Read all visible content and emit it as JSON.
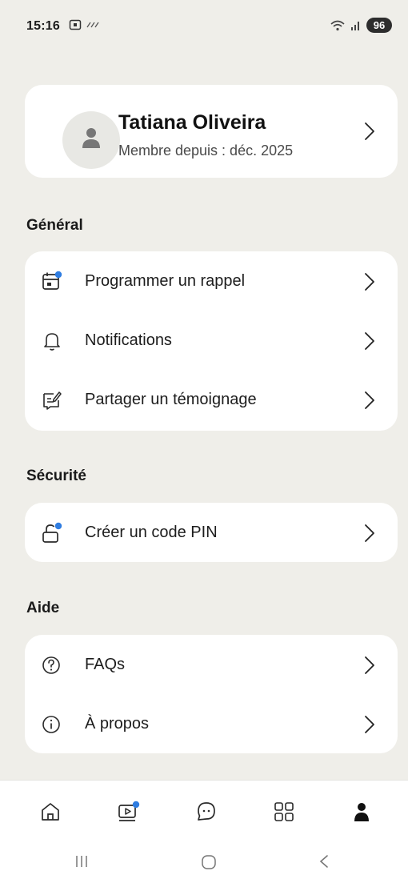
{
  "status": {
    "time": "15:16",
    "battery": "96"
  },
  "profile": {
    "name": "Tatiana Oliveira",
    "member_since": "Membre depuis : déc. 2025"
  },
  "sections": {
    "general": {
      "title": "Général",
      "items": [
        {
          "label": "Programmer un rappel",
          "icon": "calendar-icon"
        },
        {
          "label": "Notifications",
          "icon": "bell-icon"
        },
        {
          "label": "Partager un témoignage",
          "icon": "edit-note-icon"
        }
      ]
    },
    "security": {
      "title": "Sécurité",
      "items": [
        {
          "label": "Créer un code PIN",
          "icon": "lock-icon"
        }
      ]
    },
    "help": {
      "title": "Aide",
      "items": [
        {
          "label": "FAQs",
          "icon": "question-icon"
        },
        {
          "label": "À propos",
          "icon": "info-icon"
        }
      ]
    }
  },
  "bottom_nav": [
    "home-icon",
    "video-icon",
    "chat-icon",
    "grid-icon",
    "profile-icon"
  ],
  "colors": {
    "background": "#efeee9",
    "card": "#ffffff",
    "accent_dot": "#2f7de1",
    "text": "#1b1b1b"
  }
}
